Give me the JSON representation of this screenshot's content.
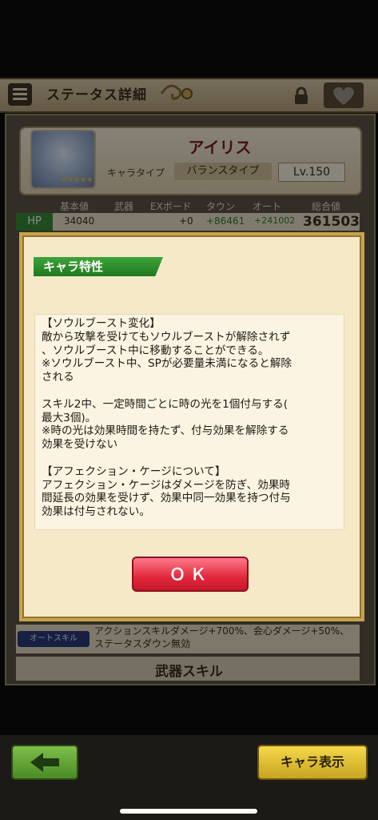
{
  "header": {
    "title": "ステータス詳細"
  },
  "character": {
    "name": "アイリス",
    "type_label": "キャラタイプ",
    "type_value": "バランスタイプ",
    "level": "Lv.150",
    "rarity": "★★★★★"
  },
  "stats": {
    "headers": [
      "基本値",
      "武器",
      "EXボード",
      "タウン",
      "オート",
      "総合値"
    ],
    "hp": {
      "label": "HP",
      "base": "34040",
      "weapon": "",
      "exboard": "+0",
      "town": "+86461",
      "auto": "+241002",
      "total": "361503"
    }
  },
  "auto_skill": {
    "tag": "オートスキル",
    "text": "アクションスキルダメージ+700%、会心ダメージ+50%、ステータスダウン無効"
  },
  "weapon_skill": {
    "label": "武器スキル"
  },
  "modal": {
    "tag": "キャラ特性",
    "text": "【ソウルブースト変化】\n敵から攻撃を受けてもソウルブーストが解除されず\n、ソウルブースト中に移動することができる。\n※ソウルブースト中、SPが必要量未満になると解除\nされる\n\nスキル2中、一定時間ごとに時の光を1個付与する(\n最大3個)。\n※時の光は効果時間を持たず、付与効果を解除する\n効果を受けない\n\n【アフェクション・ケージについて】\nアフェクション・ケージはダメージを防ぎ、効果時\n間延長の効果を受けず、効果中同一効果を持つ付与\n効果は付与されない。",
    "ok_label": "ＯＫ"
  },
  "footer": {
    "chara_button": "キャラ表示"
  },
  "colors": {
    "accent_green": "#2c7a2c",
    "ok_red": "#e0283c",
    "modal_border": "#c7a44a"
  },
  "icons": [
    "menu-icon",
    "lock-icon",
    "heart-icon",
    "back-arrow-icon"
  ]
}
